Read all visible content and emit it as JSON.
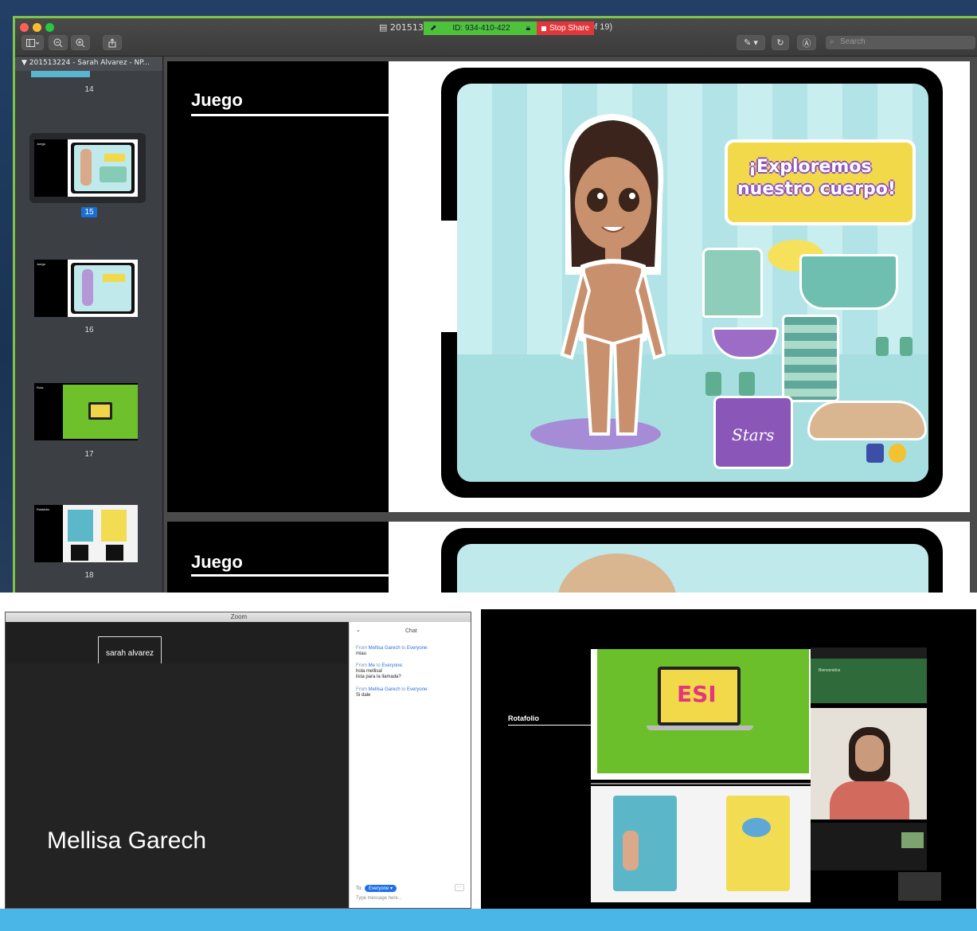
{
  "preview": {
    "doc_title_left": "2015132",
    "doc_title_right": "of 19)",
    "meeting_id": "ID: 934-410-422",
    "stop_share": "Stop Share",
    "search_placeholder": "Search",
    "sidebar_header": "201513224 - Sarah Alvarez - NP...",
    "thumbnails": [
      {
        "label": "14",
        "title": ""
      },
      {
        "label": "15",
        "title": "Juego"
      },
      {
        "label": "16",
        "title": "Juego"
      },
      {
        "label": "17",
        "title": "Ruta"
      },
      {
        "label": "18",
        "title": "Rotafolio"
      }
    ],
    "page1": {
      "heading": "Juego",
      "banner_line1": "¡Exploremos",
      "banner_line2": "nuestro cuerpo!",
      "shirt_text": "Stars"
    },
    "page2": {
      "heading": "Juego"
    }
  },
  "zoom": {
    "window_title": "Zoom",
    "participant_tile": "sarah alvarez",
    "active_speaker": "Mellisa Garech",
    "chat": {
      "title": "Chat",
      "messages": [
        {
          "from_prefix": "From",
          "sender": "Mellisa Garech",
          "to_prefix": "to",
          "recipient": "Everyone",
          "suffix": ":",
          "text": "miau"
        },
        {
          "from_prefix": "From",
          "sender": "Me",
          "to_prefix": "to",
          "recipient": "Everyone",
          "suffix": ":",
          "text": "hola mellisa!\nlista para la llamada?"
        },
        {
          "from_prefix": "From",
          "sender": "Mellisa Garech",
          "to_prefix": "to",
          "recipient": "Everyone",
          "suffix": ":",
          "text": "Si dale"
        }
      ],
      "to_label": "To:",
      "to_value": "Everyone",
      "input_placeholder": "Type message here..."
    }
  },
  "share": {
    "rotafolio_label": "Rotafolio",
    "laptop_title": "ESI",
    "meeting_mini_text": "Bienvenidos"
  },
  "colors": {
    "zoom_green": "#4fc23b",
    "stop_red": "#e0383a",
    "slide_teal": "#b8e8ea",
    "banner_yellow": "#f2d94a",
    "blue_bar": "#4ab6e8"
  }
}
